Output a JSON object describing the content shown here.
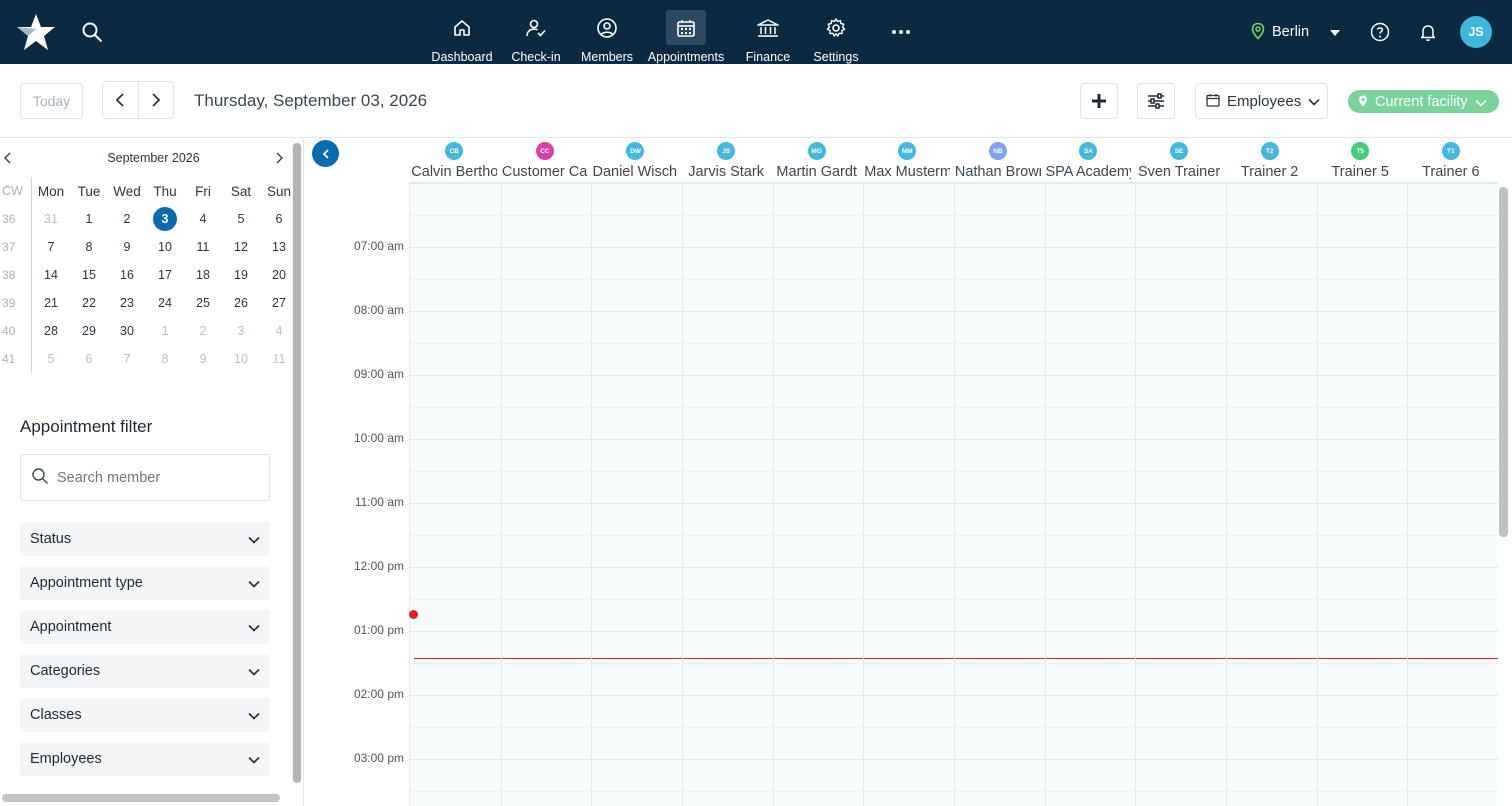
{
  "nav": {
    "items": [
      {
        "label": "Dashboard",
        "icon": "home-icon"
      },
      {
        "label": "Check-in",
        "icon": "check-in-icon"
      },
      {
        "label": "Members",
        "icon": "members-icon"
      },
      {
        "label": "Appointments",
        "icon": "calendar-icon"
      },
      {
        "label": "Finance",
        "icon": "bank-icon"
      },
      {
        "label": "Settings",
        "icon": "gear-icon"
      }
    ],
    "active": "Appointments",
    "location": "Berlin",
    "user_initials": "JS"
  },
  "toolbar": {
    "today_label": "Today",
    "date_title": "Thursday, September 03, 2026",
    "view_select": "Employees",
    "facility_label": "Current facility"
  },
  "mini_calendar": {
    "title": "September 2026",
    "cw_label": "CW",
    "weekdays": [
      "Mon",
      "Tue",
      "Wed",
      "Thu",
      "Fri",
      "Sat",
      "Sun"
    ],
    "weeks": [
      {
        "cw": "36",
        "days": [
          [
            "31",
            true
          ],
          [
            "1",
            false
          ],
          [
            "2",
            false
          ],
          [
            "3",
            false
          ],
          [
            "4",
            false
          ],
          [
            "5",
            false
          ],
          [
            "6",
            false
          ]
        ]
      },
      {
        "cw": "37",
        "days": [
          [
            "7",
            false
          ],
          [
            "8",
            false
          ],
          [
            "9",
            false
          ],
          [
            "10",
            false
          ],
          [
            "11",
            false
          ],
          [
            "12",
            false
          ],
          [
            "13",
            false
          ]
        ]
      },
      {
        "cw": "38",
        "days": [
          [
            "14",
            false
          ],
          [
            "15",
            false
          ],
          [
            "16",
            false
          ],
          [
            "17",
            false
          ],
          [
            "18",
            false
          ],
          [
            "19",
            false
          ],
          [
            "20",
            false
          ]
        ]
      },
      {
        "cw": "39",
        "days": [
          [
            "21",
            false
          ],
          [
            "22",
            false
          ],
          [
            "23",
            false
          ],
          [
            "24",
            false
          ],
          [
            "25",
            false
          ],
          [
            "26",
            false
          ],
          [
            "27",
            false
          ]
        ]
      },
      {
        "cw": "40",
        "days": [
          [
            "28",
            false
          ],
          [
            "29",
            false
          ],
          [
            "30",
            false
          ],
          [
            "1",
            true
          ],
          [
            "2",
            true
          ],
          [
            "3",
            true
          ],
          [
            "4",
            true
          ]
        ]
      },
      {
        "cw": "41",
        "days": [
          [
            "5",
            true
          ],
          [
            "6",
            true
          ],
          [
            "7",
            true
          ],
          [
            "8",
            true
          ],
          [
            "9",
            true
          ],
          [
            "10",
            true
          ],
          [
            "11",
            true
          ]
        ]
      }
    ],
    "selected": "3"
  },
  "filter": {
    "title": "Appointment filter",
    "search_placeholder": "Search member",
    "groups": [
      "Status",
      "Appointment type",
      "Appointment",
      "Categories",
      "Classes",
      "Employees"
    ]
  },
  "employees": [
    {
      "initials": "CB",
      "name": "Calvin Berthold",
      "color": "#45b8e0"
    },
    {
      "initials": "CC",
      "name": "Customer Care",
      "color": "#d83fa7"
    },
    {
      "initials": "DW",
      "name": "Daniel Wischnewski",
      "color": "#45b8e0"
    },
    {
      "initials": "JS",
      "name": "Jarvis Stark",
      "color": "#45b8e0"
    },
    {
      "initials": "MG",
      "name": "Martin Gardt",
      "color": "#45b8e0"
    },
    {
      "initials": "MM",
      "name": "Max Mustermann",
      "color": "#45b8e0"
    },
    {
      "initials": "NB",
      "name": "Nathan Brown",
      "color": "#7fa3f0"
    },
    {
      "initials": "SA",
      "name": "SPA Academy",
      "color": "#45b8e0"
    },
    {
      "initials": "SE",
      "name": "Sven Trainer",
      "color": "#45b8e0"
    },
    {
      "initials": "T2",
      "name": "Trainer 2",
      "color": "#45b8e0"
    },
    {
      "initials": "T5",
      "name": "Trainer 5",
      "color": "#3fcf7a"
    },
    {
      "initials": "T1",
      "name": "Trainer 6",
      "color": "#45b8e0"
    }
  ],
  "time_labels": [
    "07:00 am",
    "08:00 am",
    "09:00 am",
    "10:00 am",
    "11:00 am",
    "12:00 pm",
    "01:00 pm",
    "02:00 pm",
    "03:00 pm"
  ],
  "colors": {
    "nav_bg": "#0b2a42",
    "accent": "#0a6bb0",
    "facility": "#7ad49a",
    "now_line": "#e21f26"
  }
}
